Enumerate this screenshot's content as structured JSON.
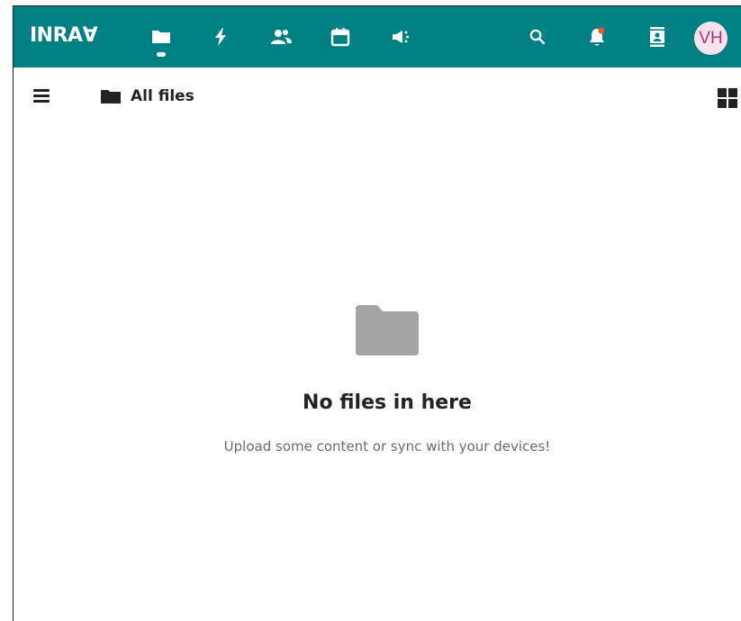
{
  "app": {
    "logo": "INRAⱯ"
  },
  "topbar": {
    "nav_icons": [
      "files-icon",
      "activity-icon",
      "contacts-icon",
      "calendar-icon",
      "announcements-icon"
    ],
    "right_icons": [
      "search-icon",
      "notifications-icon",
      "contacts-menu-icon"
    ],
    "avatar_initials": "VH",
    "color": "#008082"
  },
  "toolbar": {
    "breadcrumb_label": "All files"
  },
  "empty_state": {
    "title": "No files in here",
    "subtitle": "Upload some content or sync with your devices!"
  }
}
